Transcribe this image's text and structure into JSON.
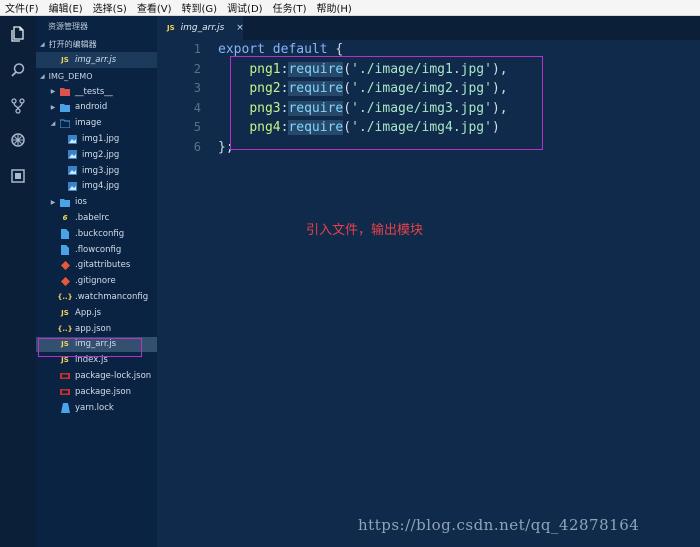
{
  "menu": [
    "文件(F)",
    "编辑(E)",
    "选择(S)",
    "查看(V)",
    "转到(G)",
    "调试(D)",
    "任务(T)",
    "帮助(H)"
  ],
  "activity_icons": [
    "files-icon",
    "search-icon",
    "source-control-icon",
    "debug-icon",
    "extensions-icon"
  ],
  "sidebar": {
    "title": "资源管理器",
    "open_editors_label": "打开的编辑器",
    "open_editor_file": "img_arr.js",
    "project_label": "IMG_DEMO",
    "tree": [
      {
        "label": "__tests__",
        "icon": "folder-red-icon",
        "type": "folder-collapsed",
        "depth": 0
      },
      {
        "label": "android",
        "icon": "folder-icon",
        "type": "folder-collapsed",
        "depth": 0
      },
      {
        "label": "image",
        "icon": "folder-open-icon",
        "type": "folder-open",
        "depth": 0
      },
      {
        "label": "img1.jpg",
        "icon": "image-file-icon",
        "type": "file",
        "depth": 1
      },
      {
        "label": "img2.jpg",
        "icon": "image-file-icon",
        "type": "file",
        "depth": 1
      },
      {
        "label": "img3.jpg",
        "icon": "image-file-icon",
        "type": "file",
        "depth": 1
      },
      {
        "label": "img4.jpg",
        "icon": "image-file-icon",
        "type": "file",
        "depth": 1
      },
      {
        "label": "ios",
        "icon": "folder-icon",
        "type": "folder-collapsed",
        "depth": 0
      },
      {
        "label": ".babelrc",
        "icon": "babel-file-icon",
        "type": "file",
        "depth": 0
      },
      {
        "label": ".buckconfig",
        "icon": "config-file-icon",
        "type": "file",
        "depth": 0
      },
      {
        "label": ".flowconfig",
        "icon": "config-file-icon",
        "type": "file",
        "depth": 0
      },
      {
        "label": ".gitattributes",
        "icon": "git-file-icon",
        "type": "file",
        "depth": 0
      },
      {
        "label": ".gitignore",
        "icon": "git-file-icon",
        "type": "file",
        "depth": 0
      },
      {
        "label": ".watchmanconfig",
        "icon": "json-file-icon",
        "type": "file",
        "depth": 0
      },
      {
        "label": "App.js",
        "icon": "js-file-icon",
        "type": "file",
        "depth": 0
      },
      {
        "label": "app.json",
        "icon": "json-file-icon",
        "type": "file",
        "depth": 0
      },
      {
        "label": "img_arr.js",
        "icon": "js-file-icon",
        "type": "file",
        "depth": 0,
        "selected": true
      },
      {
        "label": "index.js",
        "icon": "js-file-icon",
        "type": "file",
        "depth": 0
      },
      {
        "label": "package-lock.json",
        "icon": "npm-file-icon",
        "type": "file",
        "depth": 0
      },
      {
        "label": "package.json",
        "icon": "npm-file-icon",
        "type": "file",
        "depth": 0
      },
      {
        "label": "yarn.lock",
        "icon": "yarn-file-icon",
        "type": "file",
        "depth": 0
      }
    ]
  },
  "editor": {
    "tab_label": "img_arr.js",
    "tab_badge": "JS",
    "close_glyph": "×",
    "lines": [
      {
        "num": "1",
        "tokens": [
          [
            "kw",
            "export"
          ],
          [
            "pun",
            " "
          ],
          [
            "kw",
            "default"
          ],
          [
            "pun",
            " {"
          ]
        ]
      },
      {
        "num": "2",
        "tokens": [
          [
            "pun",
            "    "
          ],
          [
            "id",
            "png1"
          ],
          [
            "pun",
            ":"
          ],
          [
            "fn hl",
            "require"
          ],
          [
            "pun",
            "("
          ],
          [
            "str",
            "'./image/img1.jpg'"
          ],
          [
            "pun",
            "),"
          ]
        ]
      },
      {
        "num": "3",
        "tokens": [
          [
            "pun",
            "    "
          ],
          [
            "id",
            "png2"
          ],
          [
            "pun",
            ":"
          ],
          [
            "fn hl",
            "require"
          ],
          [
            "pun",
            "("
          ],
          [
            "str",
            "'./image/img2.jpg'"
          ],
          [
            "pun",
            "),"
          ]
        ]
      },
      {
        "num": "4",
        "tokens": [
          [
            "pun",
            "    "
          ],
          [
            "id",
            "png3"
          ],
          [
            "pun",
            ":"
          ],
          [
            "fn hl",
            "require"
          ],
          [
            "pun",
            "("
          ],
          [
            "str",
            "'./image/img3.jpg'"
          ],
          [
            "pun",
            "),"
          ]
        ]
      },
      {
        "num": "5",
        "tokens": [
          [
            "pun",
            "    "
          ],
          [
            "id",
            "png4"
          ],
          [
            "pun",
            ":"
          ],
          [
            "fn hl",
            "require"
          ],
          [
            "pun",
            "("
          ],
          [
            "str",
            "'./image/img4.jpg'"
          ],
          [
            "pun",
            ")"
          ]
        ]
      },
      {
        "num": "6",
        "tokens": [
          [
            "pun",
            "};"
          ]
        ]
      }
    ]
  },
  "annotation": "引入文件，输出模块",
  "watermark": "https://blog.csdn.net/qq_42878164",
  "colors": {
    "highlight_box": "#b532c9",
    "annotation": "#e8414b",
    "editor_bg": "#0f2a4a"
  }
}
